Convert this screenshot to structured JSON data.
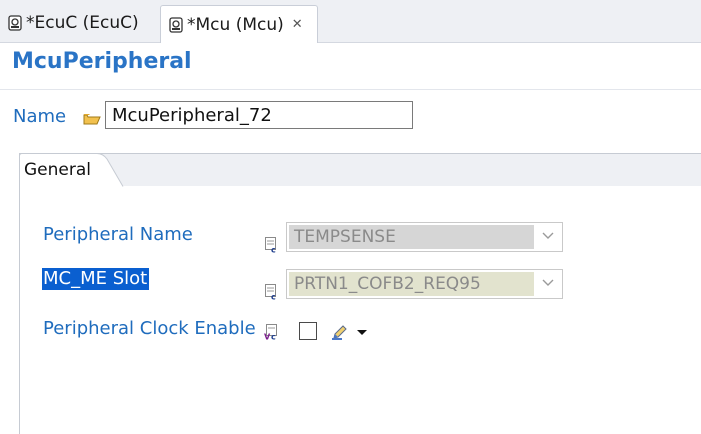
{
  "tabs": [
    {
      "label": "*EcuC (EcuC)",
      "active": false
    },
    {
      "label": "*Mcu (Mcu)",
      "active": true,
      "close_icon": "close-x-icon"
    }
  ],
  "header": {
    "title": "McuPeripheral"
  },
  "name_field": {
    "label": "Name",
    "value": "McuPeripheral_72",
    "icon": "folder-icon"
  },
  "section": {
    "tab_label": "General"
  },
  "fields": {
    "peripheral_name": {
      "label": "Peripheral Name",
      "value": "TEMPSENSE",
      "icon": "config-c-icon"
    },
    "slot": {
      "label": "MC_ME Slot",
      "value": "PRTN1_COFB2_REQ95",
      "icon": "config-c-icon"
    },
    "clock_enable": {
      "label": "Peripheral Clock Enable",
      "checked": false,
      "icon": "config-vc-icon",
      "tool_icon": "edit-pencil-icon"
    }
  },
  "colors": {
    "accent": "#2a74c6",
    "label": "#1f6cbd",
    "selection": "#0a5fd0"
  }
}
